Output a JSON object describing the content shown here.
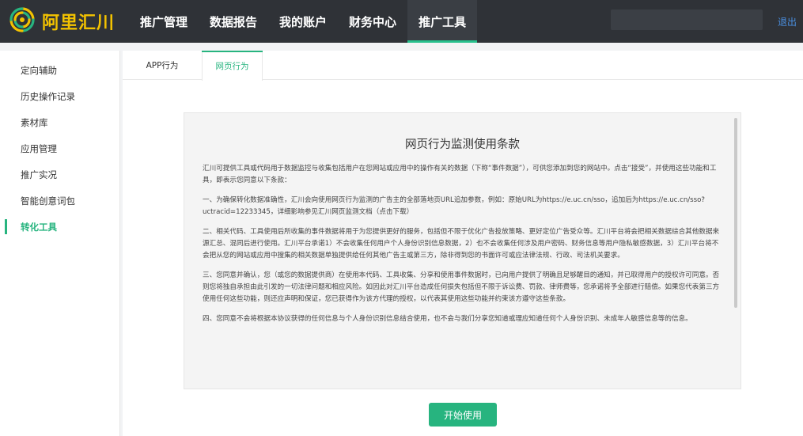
{
  "header": {
    "logo_text": "阿里汇川",
    "logo_icon": "spiral-logo-icon",
    "nav": [
      {
        "label": "推广管理"
      },
      {
        "label": "数据报告"
      },
      {
        "label": "我的账户"
      },
      {
        "label": "财务中心"
      },
      {
        "label": "推广工具",
        "active": true
      }
    ],
    "logout_label": "退出"
  },
  "sidebar": {
    "items": [
      {
        "label": "定向辅助"
      },
      {
        "label": "历史操作记录"
      },
      {
        "label": "素材库"
      },
      {
        "label": "应用管理"
      },
      {
        "label": "推广实况"
      },
      {
        "label": "智能创意词包"
      },
      {
        "label": "转化工具",
        "active": true
      }
    ]
  },
  "tabs": [
    {
      "label": "APP行为"
    },
    {
      "label": "网页行为",
      "active": true
    }
  ],
  "terms": {
    "title": "网页行为监测使用条款",
    "paragraphs": [
      "汇川可提供工具或代码用于数据监控与收集包括用户在您网站或应用中的操作有关的数据（下称“事件数据”），可供您添加到您的网站中。点击“接受”，并使用这些功能和工具，即表示您同意以下条款：",
      "一、为确保转化数据准确性，汇川会向使用网页行为监测的广告主的全部落地页URL追加参数，例如：原始URL为https://e.uc.cn/sso，追加后为https://e.uc.cn/sso? uctracid=12233345，详细影响参见汇川网页监测文档（点击下载）",
      "二、相关代码、工具使用后所收集的事件数据将用于为您提供更好的服务，包括但不限于优化广告投放策略、更好定位广告受众等。汇川平台将会把相关数据综合其他数据来源汇总、混同后进行使用。汇川平台承诺1）不会收集任何用户个人身份识别信息数据，2）也不会收集任何涉及用户密码、财务信息等用户隐私敏感数据，3）汇川平台将不会把从您的网站或应用中搜集的相关数据单独提供给任何其他广告主或第三方，除非得到您的书面许可或应法律法规、行政、司法机关要求。",
      "三、您同意并确认，您（或您的数据提供商）在使用本代码、工具收集、分享和使用事件数据时，已向用户提供了明确且足够醒目的通知，并已取得用户的授权许可同意。否则您将独自承担由此引发的一切法律问题和相应风险。如因此对汇川平台造成任何损失包括但不限于诉讼费、罚款、律师费等，您承诺将予全部进行赔偿。如果您代表第三方使用任何这些功能，则还应声明和保证，您已获得作为该方代理的授权，以代表其使用这些功能并约束该方遵守这些条款。",
      "四、您同意不会将根据本协议获得的任何信息与个人身份识别信息结合使用，也不会与我们分享您知道或理应知道任何个人身份识别、未成年人敏感信息等的信息。"
    ]
  },
  "actions": {
    "start_label": "开始使用"
  },
  "colors": {
    "accent": "#27b47f",
    "header_bg": "#2f3237",
    "logo": "#f3c200",
    "link": "#4a90e2"
  }
}
